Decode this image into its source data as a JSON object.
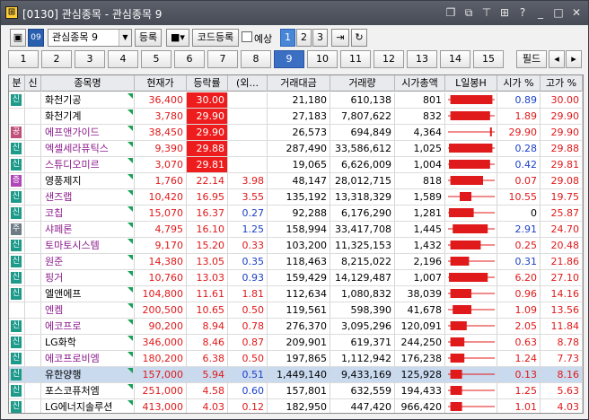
{
  "window": {
    "title": "[0130] 관심종목 - 관심종목 9"
  },
  "toolbar": {
    "group": "관심종목 9",
    "register_label": "등록",
    "code_register_label": "코드등록",
    "reserve_label": "예상",
    "page_buttons": [
      "1",
      "2",
      "3"
    ]
  },
  "tabs": [
    "1",
    "2",
    "3",
    "4",
    "5",
    "6",
    "7",
    "8",
    "9",
    "10",
    "11",
    "12",
    "13",
    "14",
    "15"
  ],
  "active_tab": "9",
  "field_label": "필드",
  "columns": [
    "분",
    "신",
    "종목명",
    "현재가",
    "등락률",
    "(외...",
    "거래대금",
    "거래량",
    "시가총액",
    "L일봉H",
    "시가 %",
    "고가 %"
  ],
  "badge_colors": {
    "신": "#2aa06a",
    "종": "#7a4aa8",
    "공": "#d2587a",
    "주": "#6d7b85",
    "증": "#b045b8",
    "신용": "#4a8f3a"
  },
  "rows": [
    {
      "badge": "신",
      "badge_color": "#1d9a8a",
      "name": "화천기공",
      "name_color": "#000",
      "price": "36,400",
      "price_color": "red",
      "rate": "30.00",
      "rate_red_bg": true,
      "foreign": "",
      "foreign_color": "red",
      "amount": "21,180",
      "volume": "610,138",
      "cap": "801",
      "spark": [
        0.05,
        0.95,
        0.5
      ],
      "open": "0.89",
      "open_color": "blue",
      "high": "30.00"
    },
    {
      "badge": "",
      "badge_color": "",
      "name": "화천기계",
      "name_color": "#000",
      "price": "3,780",
      "price_color": "red",
      "rate": "29.90",
      "rate_red_bg": true,
      "foreign": "",
      "foreign_color": "red",
      "amount": "27,183",
      "volume": "7,807,622",
      "cap": "832",
      "spark": [
        0.05,
        0.9,
        0.5
      ],
      "open": "1.89",
      "open_color": "red",
      "high": "29.90"
    },
    {
      "badge": "공",
      "badge_color": "#c0507a",
      "name": "에프앤가이드",
      "name_color": "#8b1a8b",
      "price": "38,450",
      "price_color": "red",
      "rate": "29.90",
      "rate_red_bg": true,
      "foreign": "",
      "foreign_color": "red",
      "amount": "26,573",
      "volume": "694,849",
      "cap": "4,364",
      "spark": [
        0.9,
        0.92,
        0.91
      ],
      "open": "29.90",
      "open_color": "red",
      "high": "29.90"
    },
    {
      "badge": "신",
      "badge_color": "#1d9a8a",
      "name": "엑셀세라퓨틱스",
      "name_color": "#8b1a8b",
      "price": "9,390",
      "price_color": "red",
      "rate": "29.88",
      "rate_red_bg": true,
      "foreign": "",
      "foreign_color": "red",
      "amount": "287,490",
      "volume": "33,586,612",
      "cap": "1,025",
      "spark": [
        0.02,
        0.95,
        0.5
      ],
      "open": "0.28",
      "open_color": "blue",
      "high": "29.88"
    },
    {
      "badge": "신",
      "badge_color": "#1d9a8a",
      "name": "스튜디오미르",
      "name_color": "#8b1a8b",
      "price": "3,070",
      "price_color": "red",
      "rate": "29.81",
      "rate_red_bg": true,
      "foreign": "",
      "foreign_color": "red",
      "amount": "19,065",
      "volume": "6,626,009",
      "cap": "1,004",
      "spark": [
        0.02,
        0.9,
        0.5
      ],
      "open": "0.42",
      "open_color": "blue",
      "high": "29.81"
    },
    {
      "badge": "증",
      "badge_color": "#b045b8",
      "name": "영풍제지",
      "name_color": "#000",
      "price": "1,760",
      "price_color": "red",
      "rate": "22.14",
      "rate_red_bg": false,
      "foreign": "3.98",
      "foreign_color": "red",
      "amount": "48,147",
      "volume": "28,012,715",
      "cap": "818",
      "spark": [
        0.05,
        0.75,
        0.5
      ],
      "open": "0.07",
      "open_color": "red",
      "high": "29.08"
    },
    {
      "badge": "신",
      "badge_color": "#1d9a8a",
      "name": "샌즈랩",
      "name_color": "#8b1a8b",
      "price": "10,420",
      "price_color": "red",
      "rate": "16.95",
      "rate_red_bg": false,
      "foreign": "3.55",
      "foreign_color": "red",
      "amount": "135,192",
      "volume": "13,318,329",
      "cap": "1,589",
      "spark": [
        0.25,
        0.5,
        0.4
      ],
      "open": "10.55",
      "open_color": "red",
      "high": "19.75"
    },
    {
      "badge": "신",
      "badge_color": "#1d9a8a",
      "name": "코칩",
      "name_color": "#8b1a8b",
      "price": "15,070",
      "price_color": "red",
      "rate": "16.37",
      "rate_red_bg": false,
      "foreign": "0.27",
      "foreign_color": "blue",
      "amount": "92,288",
      "volume": "6,176,290",
      "cap": "1,281",
      "spark": [
        0.02,
        0.55,
        0.4
      ],
      "open": "0",
      "open_color": "blk",
      "high": "25.87"
    },
    {
      "badge": "주",
      "badge_color": "#6d7b85",
      "name": "샤페론",
      "name_color": "#8b1a8b",
      "price": "4,795",
      "price_color": "red",
      "rate": "16.10",
      "rate_red_bg": false,
      "foreign": "1.25",
      "foreign_color": "blue",
      "amount": "158,994",
      "volume": "33,417,708",
      "cap": "1,445",
      "spark": [
        0.1,
        0.85,
        0.5
      ],
      "open": "2.91",
      "open_color": "blue",
      "high": "24.70"
    },
    {
      "badge": "신",
      "badge_color": "#1d9a8a",
      "name": "토마토시스템",
      "name_color": "#8b1a8b",
      "price": "9,170",
      "price_color": "red",
      "rate": "15.20",
      "rate_red_bg": false,
      "foreign": "0.33",
      "foreign_color": "red",
      "amount": "103,200",
      "volume": "11,325,153",
      "cap": "1,432",
      "spark": [
        0.05,
        0.7,
        0.5
      ],
      "open": "0.25",
      "open_color": "red",
      "high": "20.48"
    },
    {
      "badge": "신",
      "badge_color": "#1d9a8a",
      "name": "원준",
      "name_color": "#8b1a8b",
      "price": "14,380",
      "price_color": "red",
      "rate": "13.05",
      "rate_red_bg": false,
      "foreign": "0.35",
      "foreign_color": "blue",
      "amount": "118,463",
      "volume": "8,215,022",
      "cap": "2,196",
      "spark": [
        0.05,
        0.45,
        0.3
      ],
      "open": "0.31",
      "open_color": "blue",
      "high": "21.86"
    },
    {
      "badge": "신",
      "badge_color": "#1d9a8a",
      "name": "핑거",
      "name_color": "#8b1a8b",
      "price": "10,760",
      "price_color": "red",
      "rate": "13.03",
      "rate_red_bg": false,
      "foreign": "0.93",
      "foreign_color": "blue",
      "amount": "159,429",
      "volume": "14,129,487",
      "cap": "1,007",
      "spark": [
        0.02,
        0.85,
        0.5
      ],
      "open": "6.20",
      "open_color": "red",
      "high": "27.10"
    },
    {
      "badge": "신",
      "badge_color": "#1d9a8a",
      "name": "엘앤에프",
      "name_color": "#000",
      "price": "104,800",
      "price_color": "red",
      "rate": "11.61",
      "rate_red_bg": false,
      "foreign": "1.81",
      "foreign_color": "red",
      "amount": "112,634",
      "volume": "1,080,832",
      "cap": "38,039",
      "spark": [
        0.05,
        0.5,
        0.3
      ],
      "open": "0.96",
      "open_color": "red",
      "high": "14.16"
    },
    {
      "badge": "",
      "badge_color": "",
      "name": "엔켐",
      "name_color": "#8b1a8b",
      "price": "200,500",
      "price_color": "red",
      "rate": "10.65",
      "rate_red_bg": false,
      "foreign": "0.50",
      "foreign_color": "red",
      "amount": "119,561",
      "volume": "598,390",
      "cap": "41,678",
      "spark": [
        0.1,
        0.5,
        0.3
      ],
      "open": "1.09",
      "open_color": "red",
      "high": "13.56"
    },
    {
      "badge": "신",
      "badge_color": "#1d9a8a",
      "name": "에코프로",
      "name_color": "#8b1a8b",
      "price": "90,200",
      "price_color": "red",
      "rate": "8.94",
      "rate_red_bg": false,
      "foreign": "0.78",
      "foreign_color": "red",
      "amount": "276,370",
      "volume": "3,095,296",
      "cap": "120,091",
      "spark": [
        0.05,
        0.4,
        0.3
      ],
      "open": "2.05",
      "open_color": "red",
      "high": "11.84"
    },
    {
      "badge": "신",
      "badge_color": "#1d9a8a",
      "name": "LG화학",
      "name_color": "#000",
      "price": "346,000",
      "price_color": "red",
      "rate": "8.46",
      "rate_red_bg": false,
      "foreign": "0.87",
      "foreign_color": "red",
      "amount": "209,901",
      "volume": "619,371",
      "cap": "244,250",
      "spark": [
        0.05,
        0.35,
        0.25
      ],
      "open": "0.63",
      "open_color": "red",
      "high": "8.78"
    },
    {
      "badge": "신",
      "badge_color": "#1d9a8a",
      "name": "에코프로비엠",
      "name_color": "#8b1a8b",
      "price": "180,200",
      "price_color": "red",
      "rate": "6.38",
      "rate_red_bg": false,
      "foreign": "0.50",
      "foreign_color": "red",
      "amount": "197,865",
      "volume": "1,112,942",
      "cap": "176,238",
      "spark": [
        0.05,
        0.35,
        0.25
      ],
      "open": "1.24",
      "open_color": "red",
      "high": "7.73"
    },
    {
      "badge": "신",
      "badge_color": "#1d9a8a",
      "name": "유한양행",
      "name_color": "#000",
      "price": "157,000",
      "price_color": "red",
      "rate": "5.94",
      "rate_red_bg": false,
      "foreign": "0.51",
      "foreign_color": "blue",
      "amount": "1,449,140",
      "volume": "9,433,169",
      "cap": "125,928",
      "spark": [
        0.05,
        0.3,
        0.2
      ],
      "open": "0.13",
      "open_color": "red",
      "high": "8.16",
      "highlight": true
    },
    {
      "badge": "신",
      "badge_color": "#1d9a8a",
      "name": "포스코퓨처엠",
      "name_color": "#000",
      "price": "251,000",
      "price_color": "red",
      "rate": "4.58",
      "rate_red_bg": false,
      "foreign": "0.60",
      "foreign_color": "blue",
      "amount": "157,801",
      "volume": "632,559",
      "cap": "194,433",
      "spark": [
        0.05,
        0.3,
        0.2
      ],
      "open": "1.25",
      "open_color": "red",
      "high": "5.63"
    },
    {
      "badge": "신",
      "badge_color": "#1d9a8a",
      "name": "LG에너지솔루션",
      "name_color": "#000",
      "price": "413,000",
      "price_color": "red",
      "rate": "4.03",
      "rate_red_bg": false,
      "foreign": "0.12",
      "foreign_color": "red",
      "amount": "182,950",
      "volume": "447,420",
      "cap": "966,420",
      "spark": [
        0.05,
        0.3,
        0.2
      ],
      "open": "1.01",
      "open_color": "red",
      "high": "4.03"
    }
  ],
  "colors": {
    "up": "#e0191a",
    "down": "#1a3fc8",
    "active_tab": "#3a6fc4",
    "red_bg": "#ee1c1c"
  }
}
